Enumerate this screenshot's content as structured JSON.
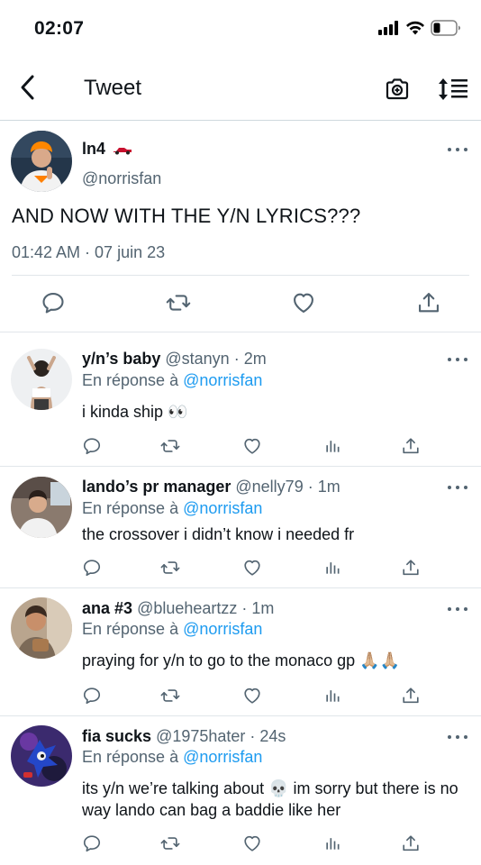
{
  "status_bar": {
    "time": "02:07"
  },
  "nav": {
    "title": "Tweet"
  },
  "main_tweet": {
    "display_name": "ln4",
    "handle": "@norrisfan",
    "text": "AND NOW WITH THE Y/N LYRICS???",
    "timestamp": "01:42 AM · 07 juin 23"
  },
  "replies": [
    {
      "display_name": "y/n’s baby",
      "handle_time": "@stanyn · 2m",
      "reply_prefix": "En réponse à",
      "reply_mention": "@norrisfan",
      "text": "i kinda ship 👀"
    },
    {
      "display_name": "lando’s pr manager",
      "handle_time": "@nelly79 · 1m",
      "reply_prefix": "En réponse à",
      "reply_mention": "@norrisfan",
      "text": "the crossover i didn’t know i needed fr"
    },
    {
      "display_name": "ana #3",
      "handle_time": "@blueheartzz · 1m",
      "reply_prefix": "En réponse à",
      "reply_mention": "@norrisfan",
      "text": "praying for y/n to go to the monaco gp 🙏🏼🙏🏼"
    },
    {
      "display_name": "fia sucks",
      "handle_time": "@1975hater · 24s",
      "reply_prefix": "En réponse à",
      "reply_mention": "@norrisfan",
      "text": "its y/n we’re talking about 💀 im sorry but there is no way lando can bag a baddie like her"
    }
  ],
  "colors": {
    "text": "#0f1419",
    "secondary": "#536471",
    "link": "#1d9bf0",
    "divider": "#e1e6ea"
  },
  "icons": [
    "back-arrow-icon",
    "camera-icon",
    "sort-icon",
    "reply-icon",
    "retweet-icon",
    "like-icon",
    "views-icon",
    "share-icon",
    "more-icon",
    "race-car-icon",
    "signal-icon",
    "wifi-icon",
    "battery-icon"
  ]
}
